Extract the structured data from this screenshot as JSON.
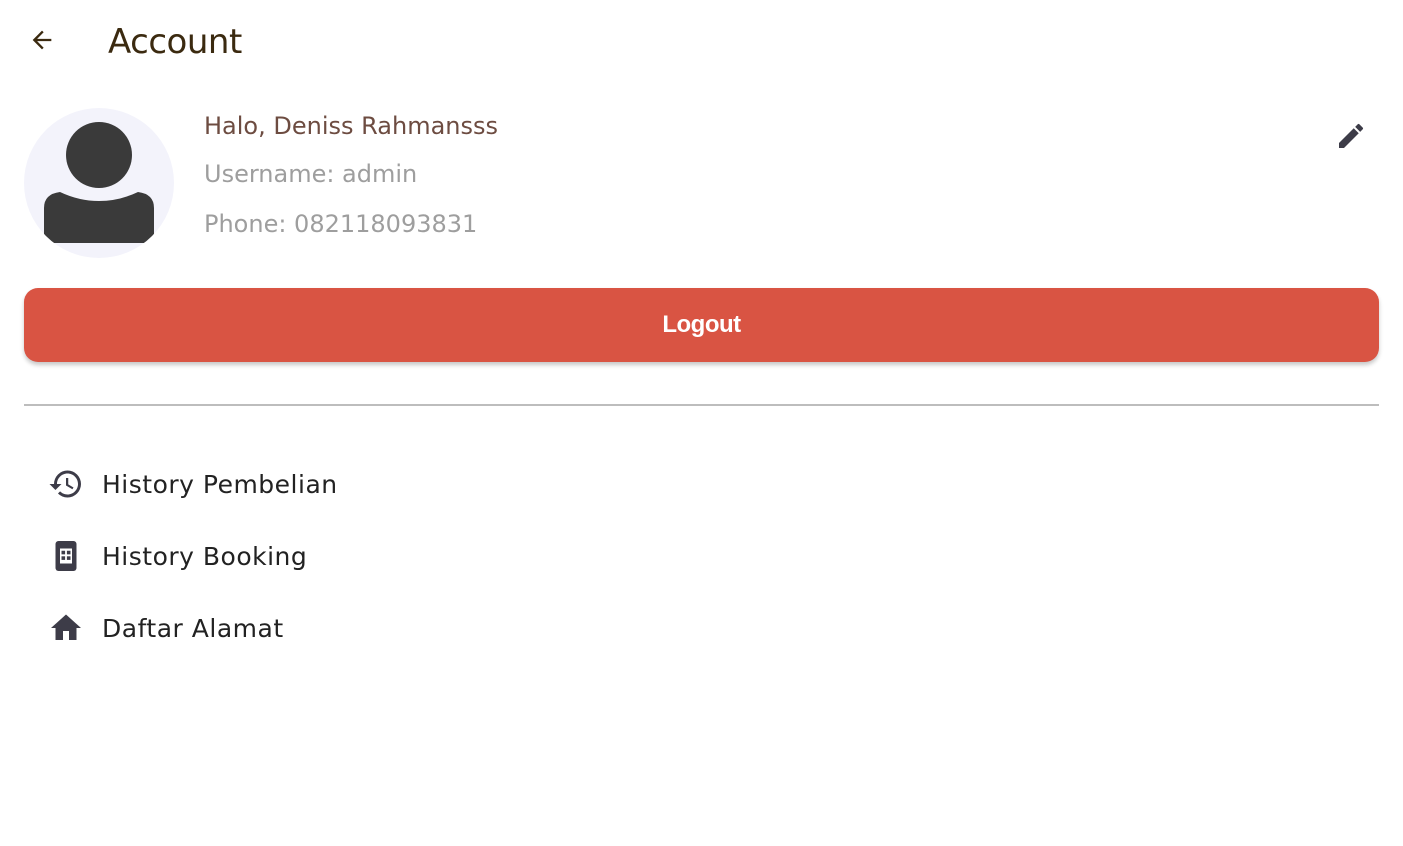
{
  "app_bar": {
    "back_icon": "arrow-back-icon",
    "title": "Account"
  },
  "profile": {
    "avatar_icon": "person-icon",
    "greeting": "Halo, Deniss Rahmansss",
    "username_line": "Username: admin",
    "phone_line": "Phone: 082118093831",
    "edit_icon": "pencil-edit-icon"
  },
  "logout_button": {
    "label": "Logout"
  },
  "menu": {
    "items": [
      {
        "label": "History Pembelian",
        "icon": "history-icon"
      },
      {
        "label": "History Booking",
        "icon": "calendar-book-icon"
      },
      {
        "label": "Daftar Alamat",
        "icon": "home-icon"
      }
    ]
  },
  "colors": {
    "title": "#3b2a10",
    "greeting": "#6d4c41",
    "muted_text": "#9e9e9e",
    "logout_bg": "#d95443",
    "icon": "#3d3c48",
    "avatar_bg": "#f3f3fb",
    "divider": "#bdbdbd"
  }
}
